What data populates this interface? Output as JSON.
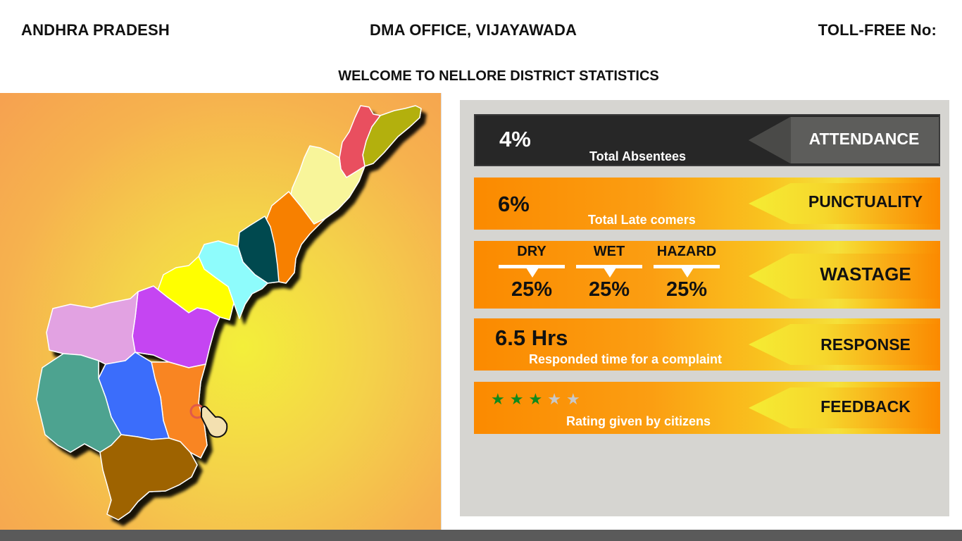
{
  "header": {
    "state": "ANDHRA PRADESH",
    "office": "DMA OFFICE, VIJAYAWADA",
    "tollfree": "TOLL-FREE No:"
  },
  "welcome": "WELCOME TO NELLORE DISTRICT STATISTICS",
  "map": {
    "selected_district": "Nellore",
    "district_colors": [
      "#e9505f",
      "#b3b00b",
      "#f8f59a",
      "#f78001",
      "#004a50",
      "#8efcfc",
      "#ffff00",
      "#c544f2",
      "#e2a2e2",
      "#3a6dfb",
      "#f98521",
      "#4ea390",
      "#9e6300"
    ]
  },
  "stats": {
    "attendance": {
      "value": "4%",
      "caption": "Total Absentees",
      "label": "ATTENDANCE"
    },
    "punctuality": {
      "value": "6%",
      "caption": "Total Late comers",
      "label": "PUNCTUALITY"
    },
    "wastage": {
      "label": "WASTAGE",
      "items": [
        {
          "name": "DRY",
          "value": "25%"
        },
        {
          "name": "WET",
          "value": "25%"
        },
        {
          "name": "HAZARD",
          "value": "25%"
        }
      ]
    },
    "response": {
      "value": "6.5 Hrs",
      "caption": "Responded time for a complaint",
      "label": "RESPONSE"
    },
    "feedback": {
      "rating": 3,
      "max_rating": 5,
      "caption": "Rating given by citizens",
      "label": "FEEDBACK",
      "star_on": "#0f8a1c",
      "star_off": "#c8c8c8"
    }
  }
}
